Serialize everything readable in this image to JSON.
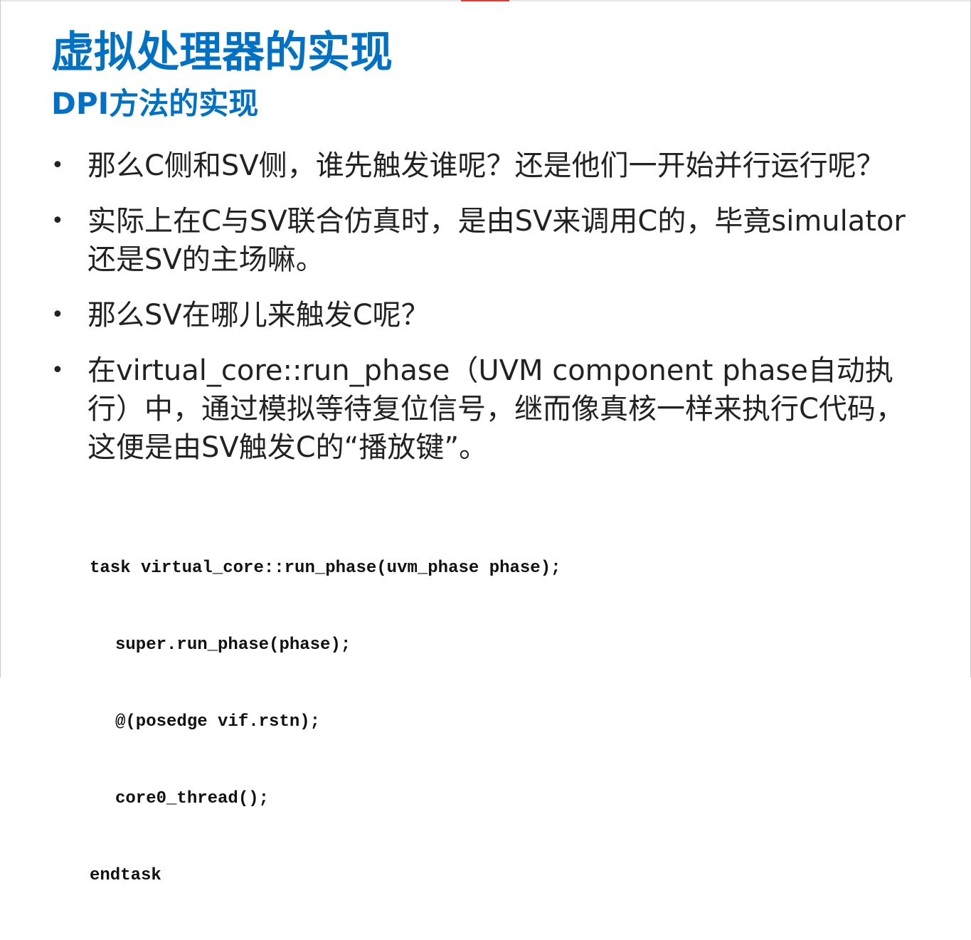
{
  "slide": {
    "title": "虚拟处理器的实现",
    "subtitle": "DPI方法的实现",
    "bullet_marker": "•",
    "bullets": [
      "那么C侧和SV侧，谁先触发谁呢？还是他们一开始并行运行呢？",
      "实际上在C与SV联合仿真时，是由SV来调用C的，毕竟simulator还是SV的主场嘛。",
      "那么SV在哪儿来触发C呢？",
      "在virtual_core::run_phase（UVM component phase自动执行）中，通过模拟等待复位信号，继而像真核一样来执行C代码，这便是由SV触发C的“播放键”。"
    ],
    "code_lines": [
      "task virtual_core::run_phase(uvm_phase phase);",
      "super.run_phase(phase);",
      "@(posedge vif.rstn);",
      "core0_thread();",
      "endtask"
    ]
  },
  "colors": {
    "accent": "#0071c5",
    "text": "#222222",
    "top_accent": "#e53935"
  }
}
